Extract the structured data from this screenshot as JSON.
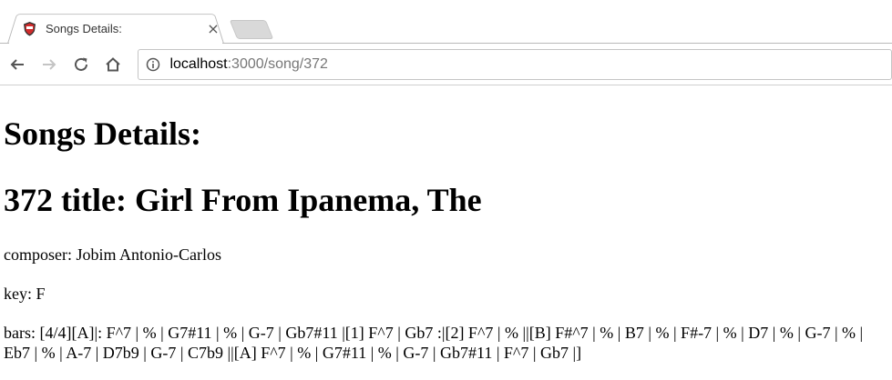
{
  "browser": {
    "tab_title": "Songs Details:",
    "close_glyph": "×",
    "url_host": "localhost",
    "url_rest": ":3000/song/372"
  },
  "page": {
    "heading": "Songs Details:",
    "title_line": "372 title: Girl From Ipanema, The",
    "composer_line": "composer: Jobim Antonio-Carlos",
    "key_line": "key: F",
    "bars_line": "bars: [4/4][A]|: F^7 | % | G7#11 | % | G-7 | Gb7#11 |[1] F^7 | Gb7 :|[2] F^7 | % ||[B] F#^7 | % | B7 | % | F#-7 | % | D7 | % | G-7 | % | Eb7 | % | A-7 | D7b9 | G-7 | C7b9 ||[A] F^7 | % | G7#11 | % | G-7 | Gb7#11 | F^7 | Gb7 |]"
  },
  "icons": {
    "favicon": "shield-favicon-icon",
    "back": "back-arrow-icon",
    "forward": "forward-arrow-icon",
    "reload": "reload-icon",
    "home": "home-icon",
    "info": "info-icon"
  },
  "colors": {
    "favicon_red": "#d22b2b",
    "favicon_dark": "#333333"
  }
}
